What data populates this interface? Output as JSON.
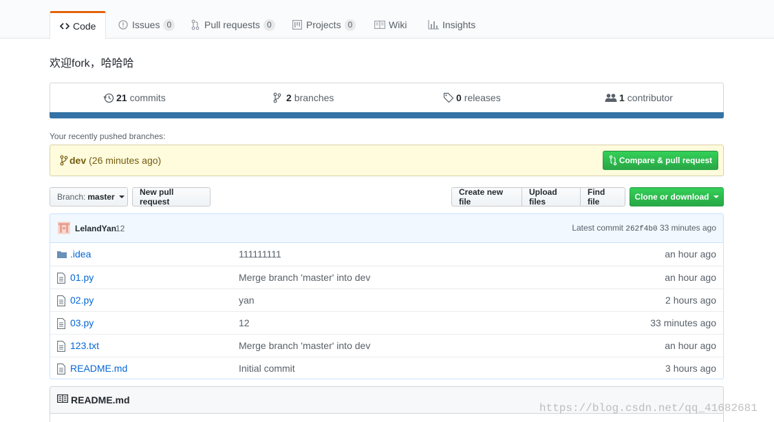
{
  "tabs": [
    {
      "label": "Code",
      "icon": "code-icon"
    },
    {
      "label": "Issues",
      "count": "0",
      "icon": "issue-opened-icon"
    },
    {
      "label": "Pull requests",
      "count": "0",
      "icon": "git-pull-request-icon"
    },
    {
      "label": "Projects",
      "count": "0",
      "icon": "project-icon"
    },
    {
      "label": "Wiki",
      "icon": "book-icon"
    },
    {
      "label": "Insights",
      "icon": "graph-icon"
    }
  ],
  "description": "欢迎fork，哈哈哈",
  "summary": {
    "commits": {
      "num": "21",
      "label": "commits"
    },
    "branches": {
      "num": "2",
      "label": "branches"
    },
    "releases": {
      "num": "0",
      "label": "releases"
    },
    "contributors": {
      "num": "1",
      "label": "contributor"
    },
    "language_color": "#3572a5"
  },
  "recent": {
    "label": "Your recently pushed branches:",
    "branch": "dev",
    "time": "(26 minutes ago)",
    "compare_label": "Compare & pull request"
  },
  "toolbar": {
    "branch_prefix": "Branch:",
    "branch": "master",
    "new_pr": "New pull request",
    "create_file": "Create new file",
    "upload": "Upload files",
    "find": "Find file",
    "clone": "Clone or download"
  },
  "commit_tease": {
    "author": "LelandYan",
    "message": "12",
    "latest_prefix": "Latest commit",
    "sha": "262f4b0",
    "time": "33 minutes ago"
  },
  "files": [
    {
      "name": ".idea",
      "type": "dir",
      "message": "111111111",
      "age": "an hour ago"
    },
    {
      "name": "01.py",
      "type": "file",
      "message": "Merge branch 'master' into dev",
      "age": "an hour ago"
    },
    {
      "name": "02.py",
      "type": "file",
      "message": "yan",
      "age": "2 hours ago"
    },
    {
      "name": "03.py",
      "type": "file",
      "message": "12",
      "age": "33 minutes ago"
    },
    {
      "name": "123.txt",
      "type": "file",
      "message": "Merge branch 'master' into dev",
      "age": "an hour ago"
    },
    {
      "name": "README.md",
      "type": "file",
      "message": "Initial commit",
      "age": "3 hours ago"
    }
  ],
  "readme": {
    "title": "README.md"
  },
  "watermark": "https://blog.csdn.net/qq_41682681",
  "colors": {
    "accent_tab": "#e36209",
    "link": "#0366d6",
    "green": "#28a745"
  }
}
